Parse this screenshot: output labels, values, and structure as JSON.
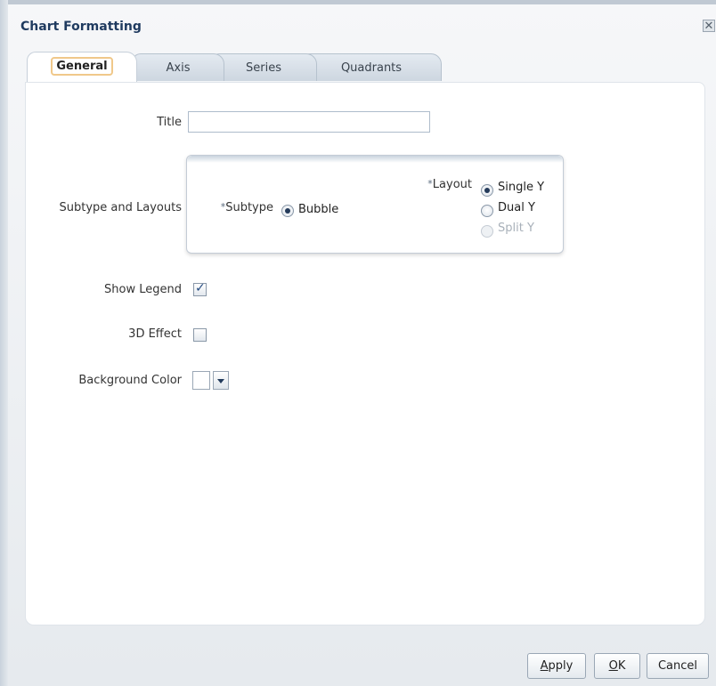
{
  "dialog": {
    "title": "Chart Formatting",
    "close_glyph": "✕"
  },
  "tabs": [
    {
      "label": "General",
      "active": true
    },
    {
      "label": "Axis",
      "active": false
    },
    {
      "label": "Series",
      "active": false
    },
    {
      "label": "Quadrants",
      "active": false
    }
  ],
  "general": {
    "title_label": "Title",
    "title_value": "",
    "subtype_layouts_label": "Subtype and Layouts",
    "required_marker": "*",
    "subtype_label": "Subtype",
    "subtype_option": "Bubble",
    "layout_label": "Layout",
    "layout_options": [
      "Single Y",
      "Dual Y",
      "Split Y"
    ],
    "layout_selected": "Single Y",
    "layout_disabled": "Split Y",
    "show_legend_label": "Show Legend",
    "show_legend_checked": true,
    "effect_3d_label": "3D Effect",
    "effect_3d_checked": false,
    "background_color_label": "Background Color",
    "background_color_value": "#ffffff"
  },
  "buttons": {
    "apply_mnemonic": "A",
    "apply_rest": "pply",
    "ok_mnemonic": "O",
    "ok_rest": "K",
    "cancel": "Cancel"
  },
  "colors": {
    "title_text": "#1f3a5f",
    "active_tab_outline": "#f0c88a"
  }
}
